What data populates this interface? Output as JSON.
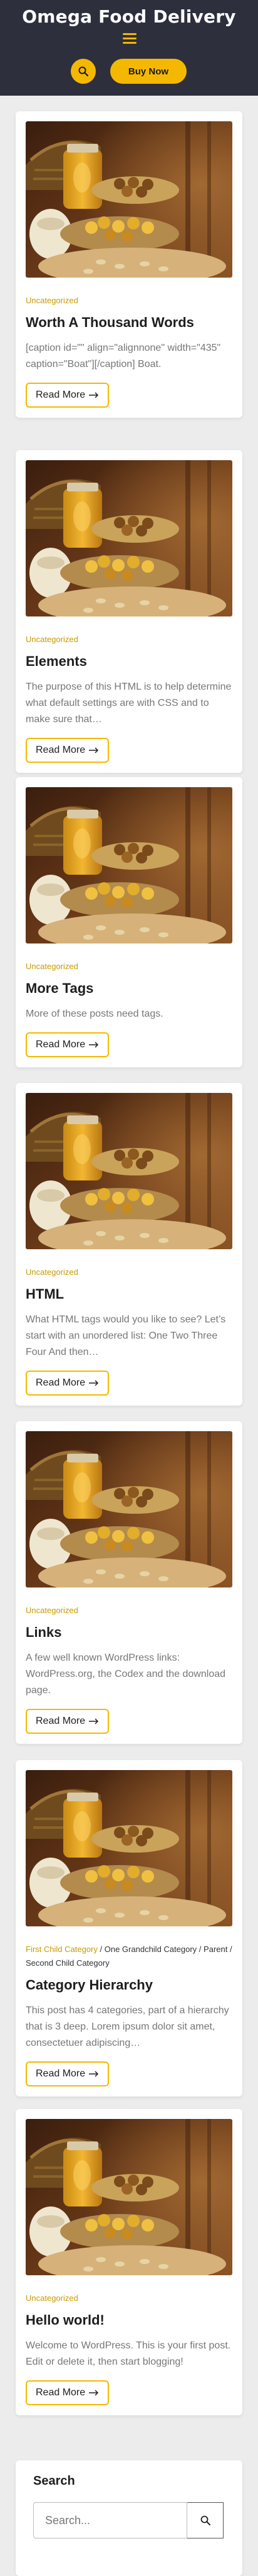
{
  "site": {
    "title": "Omega Food Delivery",
    "buy_now_label": "Buy Now",
    "accent_color": "#f5b800",
    "header_bg": "#2d2f3d",
    "icons": {
      "menu": "hamburger-menu-icon",
      "search": "search-icon",
      "arrow": "long-arrow-right-icon"
    }
  },
  "posts": [
    {
      "categories": [
        "Uncategorized"
      ],
      "title": "Worth A Thousand Words",
      "excerpt": "[caption id=\"\" align=\"alignnone\" width=\"435\" caption=\"Boat\"][/caption] Boat.",
      "read_more": "Read More"
    },
    {
      "categories": [
        "Uncategorized"
      ],
      "title": "Elements",
      "excerpt": "The purpose of this HTML is to help determine what default settings are with CSS and to make sure that…",
      "read_more": "Read More"
    },
    {
      "categories": [
        "Uncategorized"
      ],
      "title": "More Tags",
      "excerpt": "More of these posts need tags.",
      "read_more": "Read More"
    },
    {
      "categories": [
        "Uncategorized"
      ],
      "title": "HTML",
      "excerpt": "What HTML tags would you like to see? Let’s start with an unordered list: One Two Three Four And then…",
      "read_more": "Read More"
    },
    {
      "categories": [
        "Uncategorized"
      ],
      "title": "Links",
      "excerpt": "A few well known WordPress links: WordPress.org, the Codex and the download page.",
      "read_more": "Read More"
    },
    {
      "categories": [
        "First Child Category",
        "One Grandchild Category",
        "Parent",
        "Second Child Category"
      ],
      "title": "Category Hierarchy",
      "excerpt": "This post has 4 categories, part of a hierarchy that is 3 deep. Lorem ipsum dolor sit amet, consectetuer adipiscing…",
      "read_more": "Read More"
    },
    {
      "categories": [
        "Uncategorized"
      ],
      "title": "Hello world!",
      "excerpt": "Welcome to WordPress. This is your first post. Edit or delete it, then start blogging!",
      "read_more": "Read More"
    }
  ],
  "search_widget": {
    "title": "Search",
    "placeholder": "Search..."
  }
}
